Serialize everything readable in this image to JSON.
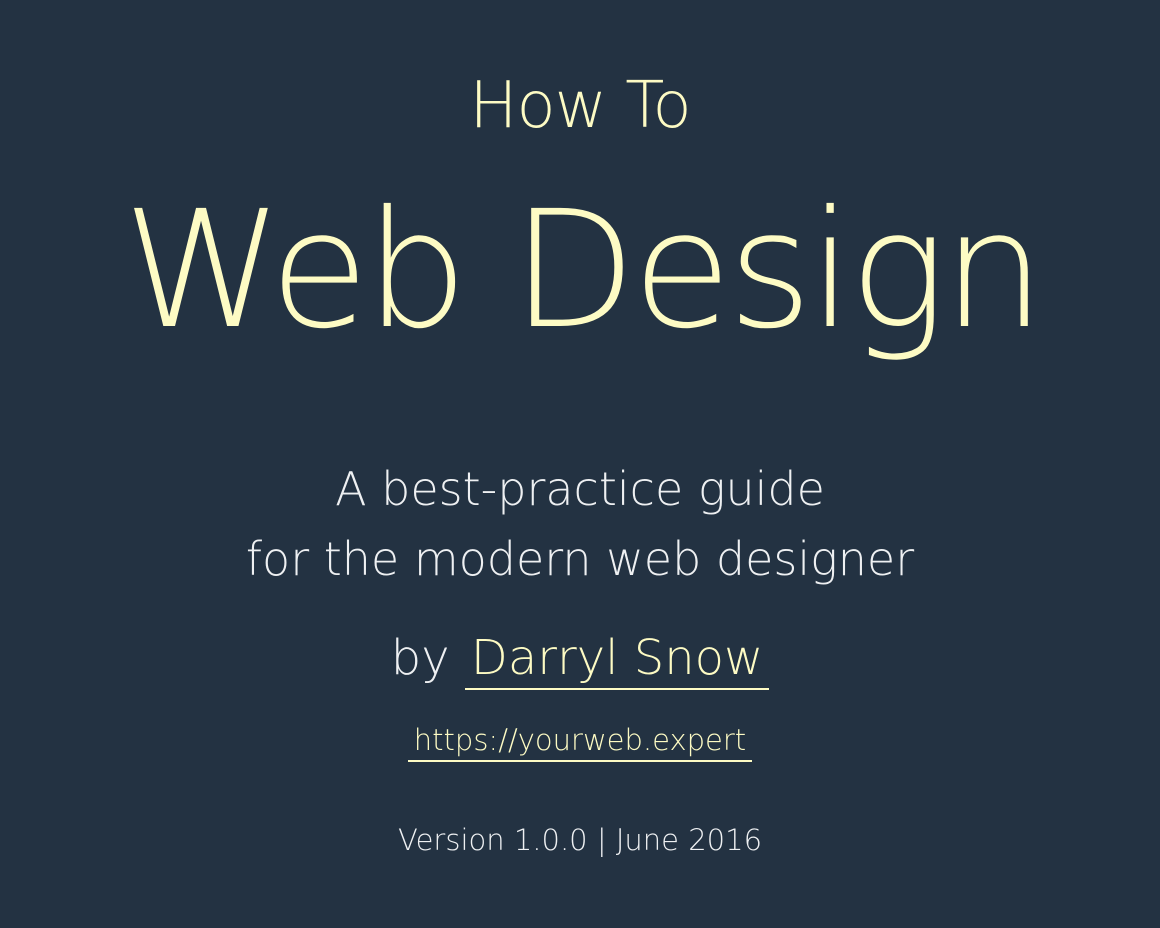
{
  "cover": {
    "pre_title": "How To",
    "title": "Web Design",
    "subtitle_line1": "A best-practice guide",
    "subtitle_line2": "for the modern web designer",
    "by_label": "by",
    "author": "Darryl Snow",
    "url": "https://yourweb.expert",
    "version": "Version 1.0.0 | June 2016"
  },
  "colors": {
    "background": "#233242",
    "accent": "#fdfbc4",
    "text": "#eef0f2"
  }
}
